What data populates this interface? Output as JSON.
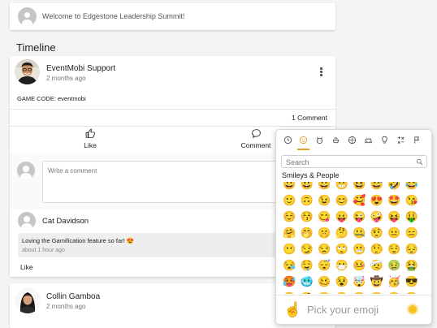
{
  "welcome": {
    "message": "Welcome to Edgestone Leadership Summit!"
  },
  "timeline": {
    "heading": "Timeline"
  },
  "post": {
    "author": "EventMobi Support",
    "time": "2 months ago",
    "body": "GAME CODE: eventmobi",
    "comment_count": "1 Comment",
    "like_label": "Like",
    "comment_label": "Comment",
    "comment_placeholder": "Write a comment"
  },
  "comment": {
    "author": "Cat Davidson",
    "text": "Loving the Gamification feature so far! 😍",
    "time": "about 1 hour ago",
    "like_label": "Like"
  },
  "post2": {
    "author": "Collin Gamboa",
    "time": "2 months ago"
  },
  "emoji_picker": {
    "accent_color": "#e2a12d",
    "categories": [
      "clock-icon",
      "smiley-icon",
      "animal-icon",
      "food-icon",
      "activity-icon",
      "travel-icon",
      "objects-icon",
      "symbols-icon",
      "flags-icon"
    ],
    "search_placeholder": "Search",
    "section_label": "Smileys & People",
    "rows": [
      [
        "😀",
        "😃",
        "😄",
        "😁",
        "😆",
        "😅",
        "🤣",
        "😂"
      ],
      [
        "🙂",
        "🙃",
        "😉",
        "😊",
        "🥰",
        "😍",
        "🤩",
        "😘"
      ],
      [
        "☺️",
        "😚",
        "😋",
        "😛",
        "😜",
        "🤪",
        "😝",
        "🤑"
      ],
      [
        "🤗",
        "🤭",
        "🤫",
        "🤔",
        "🤐",
        "🤨",
        "😐",
        "😑"
      ],
      [
        "😶",
        "😏",
        "😒",
        "🙄",
        "😬",
        "🤥",
        "😌",
        "😔"
      ],
      [
        "😪",
        "🤤",
        "😴",
        "😷",
        "🤒",
        "🤕",
        "🤢",
        "🤮"
      ],
      [
        "🥵",
        "🥶",
        "🥴",
        "😵",
        "🤯",
        "🤠",
        "🥳",
        "😎"
      ],
      [
        "🤓",
        "🧐",
        "😕",
        "😟",
        "🙁",
        "☹️",
        "😮",
        "😯"
      ]
    ],
    "preview_hand": "☝️",
    "preview_text": "Pick your emoji"
  }
}
